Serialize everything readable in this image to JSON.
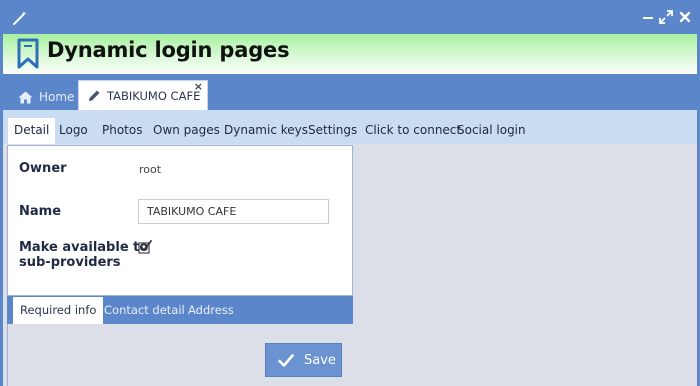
{
  "window": {
    "wand_icon": "magic-wand-icon",
    "controls": [
      "minimize-icon",
      "maximize-icon",
      "close-icon"
    ]
  },
  "header": {
    "title": "Dynamic login pages",
    "logo_icon": "bookmark-icon"
  },
  "top_tabs": {
    "home_label": "Home",
    "active_label": "TABIKUMO CAFE",
    "close_glyph": "×"
  },
  "sub_tabs": [
    {
      "label": "Detail",
      "active": true
    },
    {
      "label": "Logo"
    },
    {
      "label": "Photos"
    },
    {
      "label": "Own pages"
    },
    {
      "label": "Dynamic keys"
    },
    {
      "label": "Settings"
    },
    {
      "label": "Click to connect"
    },
    {
      "label": "Social login"
    }
  ],
  "form": {
    "owner_label": "Owner",
    "owner_value": "root",
    "name_label": "Name",
    "name_value": "TABIKUMO CAFE",
    "sub_label_line1": "Make available to",
    "sub_label_line2": "sub-providers",
    "sub_checked": true
  },
  "bottom_tabs": [
    {
      "label": "Required info",
      "active": true
    },
    {
      "label": "Contact detail"
    },
    {
      "label": "Address"
    }
  ],
  "actions": {
    "save_label": "Save"
  },
  "colors": {
    "chrome_blue": "#5b86c9",
    "subtab_bg": "#c9dcf2",
    "header_green": "#a8f0a0",
    "content_bg": "#dddfe8",
    "save_button": "#6b93d1"
  }
}
